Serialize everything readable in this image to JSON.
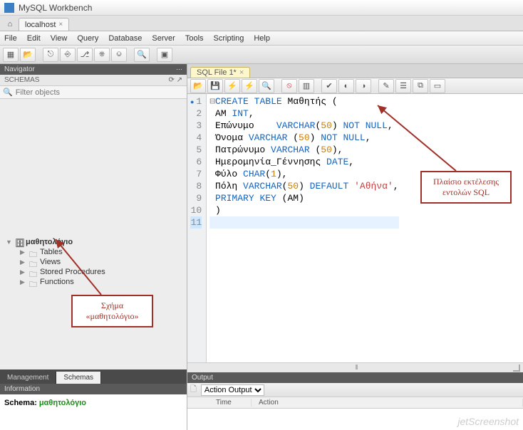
{
  "app": {
    "title": "MySQL Workbench"
  },
  "connection_tab": {
    "label": "localhost"
  },
  "menu": [
    "File",
    "Edit",
    "View",
    "Query",
    "Database",
    "Server",
    "Tools",
    "Scripting",
    "Help"
  ],
  "navigator": {
    "title": "Navigator",
    "schemas_label": "SCHEMAS",
    "filter_placeholder": "Filter objects",
    "tree": {
      "db": "μαθητολόγιο",
      "folders": [
        "Tables",
        "Views",
        "Stored Procedures",
        "Functions"
      ]
    },
    "tabs": {
      "management": "Management",
      "schemas": "Schemas"
    }
  },
  "information": {
    "header": "Information",
    "label": "Schema:",
    "value": "μαθητολόγιο"
  },
  "sql_tab": {
    "label": "SQL File 1*"
  },
  "code_lines": [
    {
      "n": 1,
      "marker": true,
      "html": "<span class='fold'>⊟</span><span class='kw'>CREATE</span> <span class='kw'>TABLE</span> Μαθητής ("
    },
    {
      "n": 2,
      "html": " AM <span class='kw'>INT</span>,"
    },
    {
      "n": 3,
      "html": " Επώνυμο    <span class='kw'>VARCHAR</span>(<span class='num'>50</span>) <span class='kw'>NOT NULL</span>,"
    },
    {
      "n": 4,
      "html": " Όνομα <span class='kw'>VARCHAR</span> (<span class='num'>50</span>) <span class='kw'>NOT NULL</span>,"
    },
    {
      "n": 5,
      "html": " Πατρώνυμο <span class='kw'>VARCHAR</span> (<span class='num'>50</span>),"
    },
    {
      "n": 6,
      "html": " Ημερομηνία_Γέννησης <span class='kw'>DATE</span>,"
    },
    {
      "n": 7,
      "html": " Φύλο <span class='kw'>CHAR</span>(<span class='num'>1</span>),"
    },
    {
      "n": 8,
      "html": " Πόλη <span class='kw'>VARCHAR</span>(<span class='num'>50</span>) <span class='kw'>DEFAULT</span> <span class='str'>'Αθήνα'</span>,"
    },
    {
      "n": 9,
      "html": " <span class='kw'>PRIMARY KEY</span> (AM)"
    },
    {
      "n": 10,
      "html": " )"
    },
    {
      "n": 11,
      "hl": true,
      "html": ""
    }
  ],
  "output": {
    "header": "Output",
    "selector": "Action Output",
    "columns": [
      "",
      "Time",
      "Action"
    ]
  },
  "annotations": {
    "schema_box": "Σχήμα\n«μαθητολόγιο»",
    "sql_box": "Πλαίσιο εκτέλεσης\nεντολών SQL"
  },
  "watermark": "jetScreenshot"
}
